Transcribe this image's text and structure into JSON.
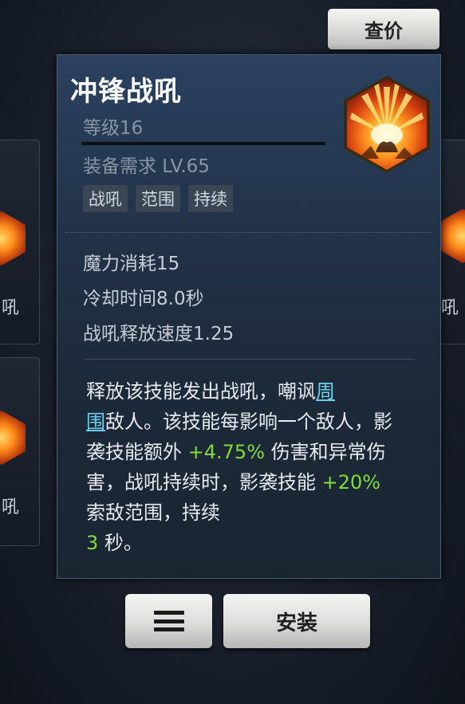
{
  "header": {
    "price_check_label": "查价"
  },
  "background": {
    "left_label_top": "吼",
    "left_label_bottom": "吼",
    "right_label": "吼"
  },
  "skill": {
    "name": "冲锋战吼",
    "level": "等级16",
    "requirement": "装备需求 LV.65",
    "tags": [
      "战吼",
      "范围",
      "持续"
    ],
    "icon": "explosion-shout-icon",
    "stats": [
      "魔力消耗15",
      "冷却时间8.0秒",
      "战吼释放速度1.25"
    ],
    "description": {
      "part1": "释放该技能发出战吼，嘲讽",
      "link1": "周",
      "line_break": "",
      "link2": "围",
      "part2": "敌人。该技能每影响一个敌人，影袭技能额外 ",
      "value1": "+4.75%",
      "part3": " 伤害和异常伤害，战吼持续时，影袭技能 ",
      "value2": "+20%",
      "part4": " 索敌范围，持续",
      "value3": "3",
      "part5": " 秒。"
    }
  },
  "actions": {
    "menu_icon": "hamburger-menu-icon",
    "install_label": "安装"
  },
  "colors": {
    "highlight_green": "#7fdc3a",
    "highlight_link": "#6bd0ee",
    "panel_bg": "#23344b"
  }
}
